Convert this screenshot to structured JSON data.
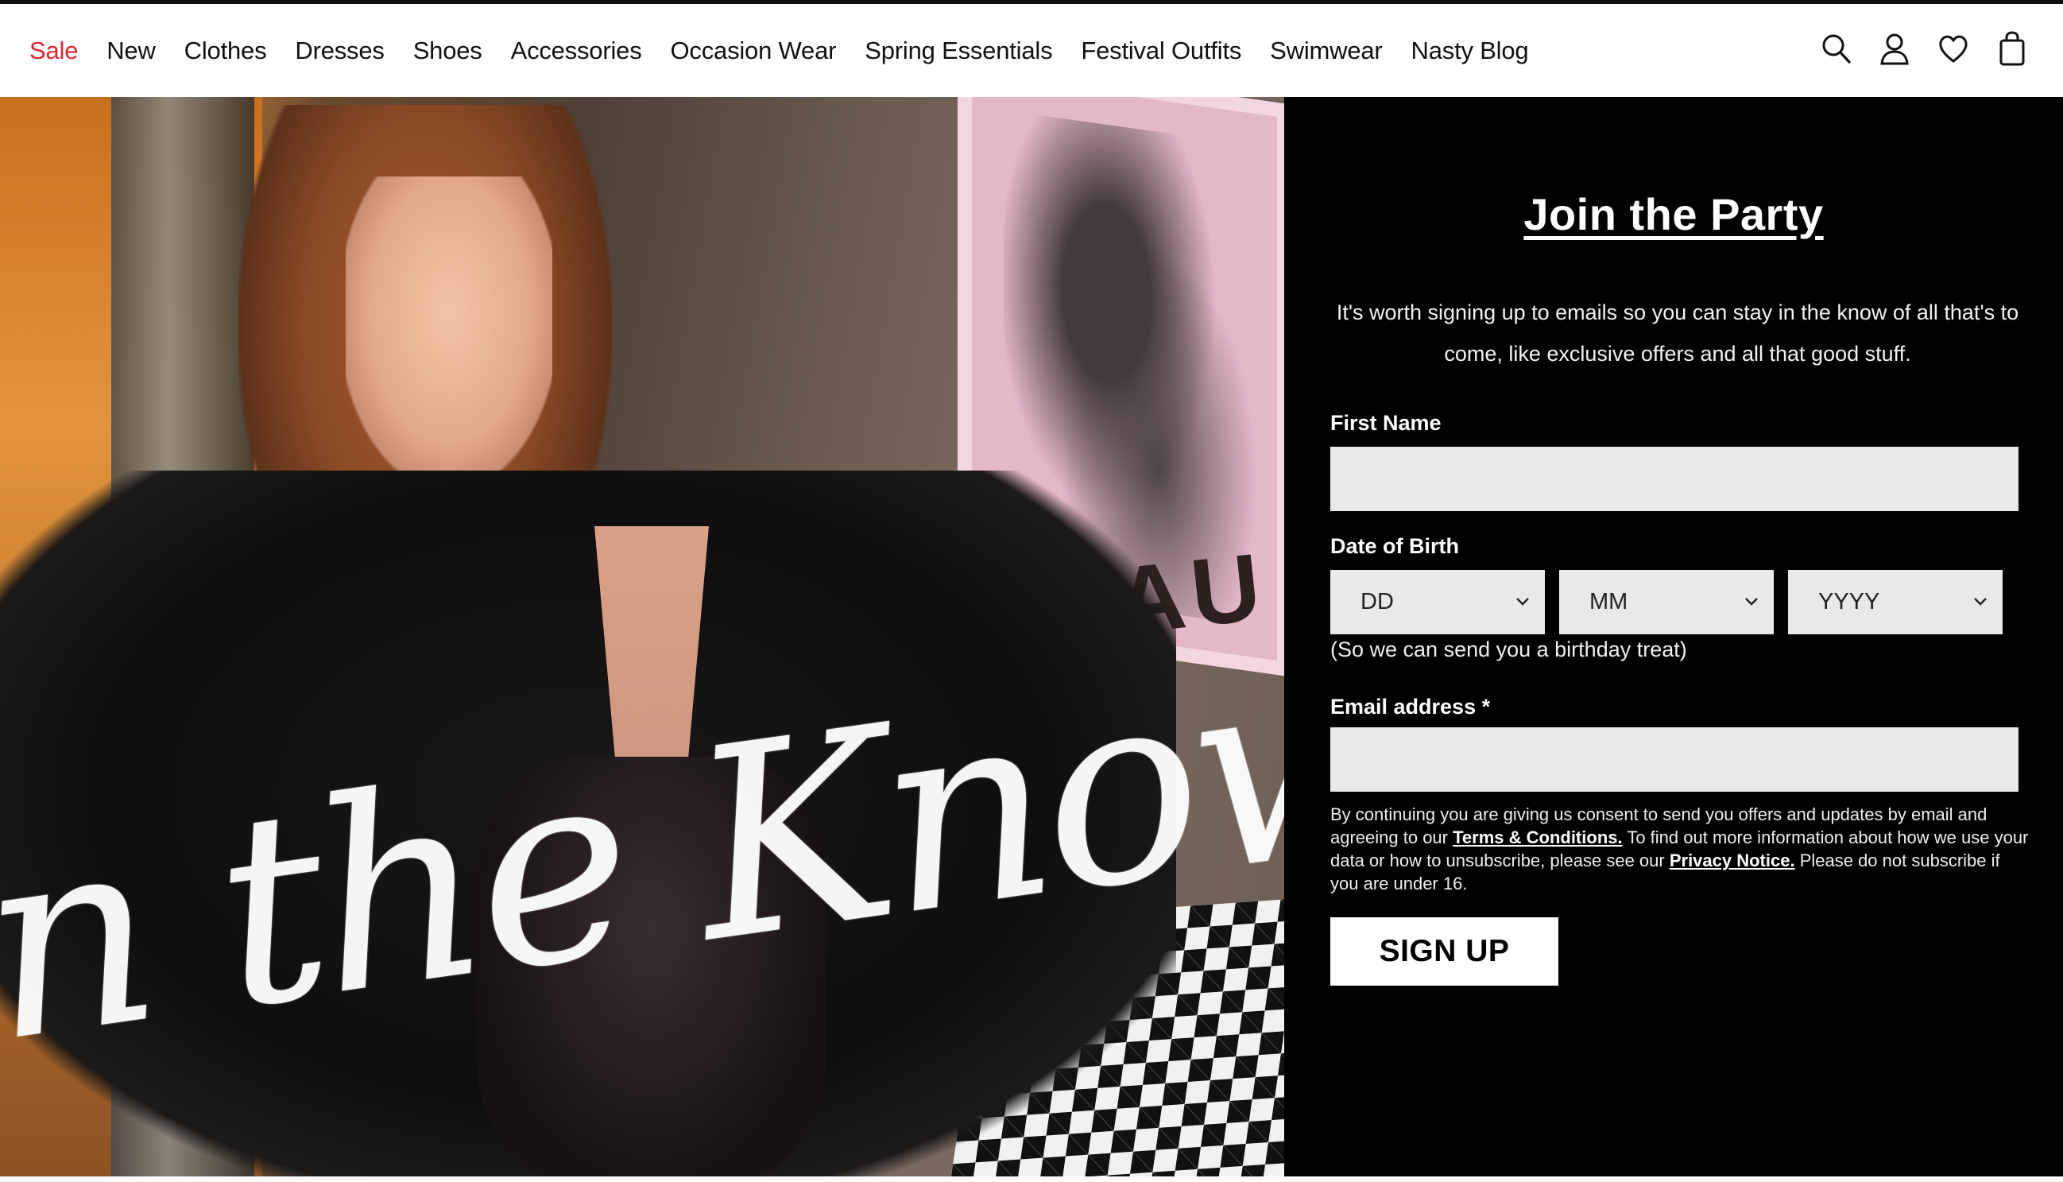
{
  "nav": {
    "items": [
      {
        "label": "Sale"
      },
      {
        "label": "New"
      },
      {
        "label": "Clothes"
      },
      {
        "label": "Dresses"
      },
      {
        "label": "Shoes"
      },
      {
        "label": "Accessories"
      },
      {
        "label": "Occasion Wear"
      },
      {
        "label": "Spring Essentials"
      },
      {
        "label": "Festival Outfits"
      },
      {
        "label": "Swimwear"
      },
      {
        "label": "Nasty Blog"
      }
    ],
    "icons": [
      "search-icon",
      "account-icon",
      "wishlist-icon",
      "bag-icon"
    ],
    "sale_color": "#e0262f"
  },
  "hero": {
    "script_text": "n the Know",
    "poster_text": "FAU"
  },
  "signup": {
    "title": "Join the Party",
    "intro": "It's worth signing up to emails so you can stay in the know of all that's to come, like exclusive offers and all that good stuff.",
    "first_name_label": "First Name",
    "first_name_value": "",
    "dob_label": "Date of Birth",
    "dob_day": "DD",
    "dob_month": "MM",
    "dob_year": "YYYY",
    "dob_hint": "(So we can send you a birthday treat)",
    "email_label": "Email address *",
    "email_value": "",
    "legal_part1": "By continuing you are giving us consent to send you offers and updates by email and agreeing to our ",
    "terms_link": "Terms & Conditions.",
    "legal_part2": " To find out more information about how we use your data or how to unsubscribe, please see our ",
    "privacy_link": "Privacy Notice.",
    "legal_part3": " Please do not subscribe if you are under 16.",
    "button_label": "SIGN UP"
  }
}
